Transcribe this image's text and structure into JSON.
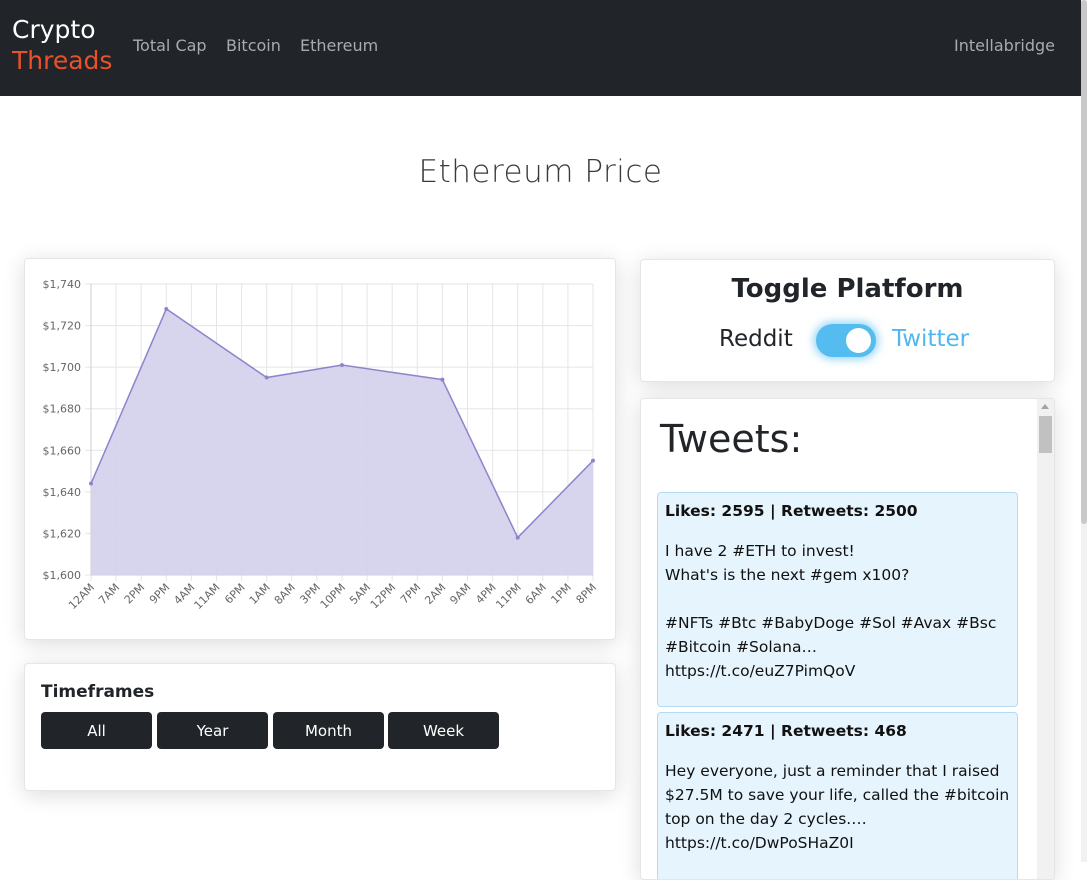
{
  "nav": {
    "brand_line1": "Crypto",
    "brand_line2": "Threads",
    "links": [
      "Total Cap",
      "Bitcoin",
      "Ethereum"
    ],
    "right_link": "Intellabridge"
  },
  "page_title": "Ethereum Price",
  "timeframes": {
    "title": "Timeframes",
    "buttons": [
      "All",
      "Year",
      "Month",
      "Week"
    ]
  },
  "toggle": {
    "title": "Toggle Platform",
    "left_label": "Reddit",
    "right_label": "Twitter",
    "state": "Twitter"
  },
  "tweets": {
    "heading": "Tweets:",
    "items": [
      {
        "meta": "Likes: 2595 | Retweets: 2500",
        "text": "I have 2 #ETH to invest!\nWhat's is the next #gem x100?\n\n#NFTs #Btc #BabyDoge #Sol #Avax #Bsc #Bitcoin #Solana…\nhttps://t.co/euZ7PimQoV"
      },
      {
        "meta": "Likes: 2471 | Retweets: 468",
        "text": "Hey everyone, just a reminder that I raised $27.5M to save your life, called the #bitcoin top on the day 2 cycles.…\nhttps://t.co/DwPoSHaZ0I"
      }
    ]
  },
  "colors": {
    "navbar": "#212428",
    "brand_accent": "#e8522a",
    "chart_fill": "#d5d2ec",
    "chart_line": "#8e84cc",
    "twitter_blue": "#4fb8ee",
    "tweet_bg": "#e6f4fd"
  },
  "chart_data": {
    "type": "area",
    "x": [
      "12AM",
      "7AM",
      "2PM",
      "9PM",
      "4AM",
      "11AM",
      "6PM",
      "1AM",
      "8AM",
      "3PM",
      "10PM",
      "5AM",
      "12PM",
      "7PM",
      "2AM",
      "9AM",
      "4PM",
      "11PM",
      "6AM",
      "1PM",
      "8PM"
    ],
    "points": [
      {
        "x": "12AM",
        "y": 1644
      },
      {
        "x": "9PM",
        "y": 1728
      },
      {
        "x": "1AM",
        "y": 1695
      },
      {
        "x": "10PM",
        "y": 1701
      },
      {
        "x": "2AM",
        "y": 1694
      },
      {
        "x": "11PM",
        "y": 1618
      },
      {
        "x": "8PM",
        "y": 1655
      }
    ],
    "yticks": [
      "$1,600",
      "$1,620",
      "$1,640",
      "$1,660",
      "$1,680",
      "$1,700",
      "$1,720",
      "$1,740"
    ],
    "ylim": [
      1600,
      1740
    ],
    "grid": true,
    "title": "",
    "xlabel": "",
    "ylabel": ""
  }
}
